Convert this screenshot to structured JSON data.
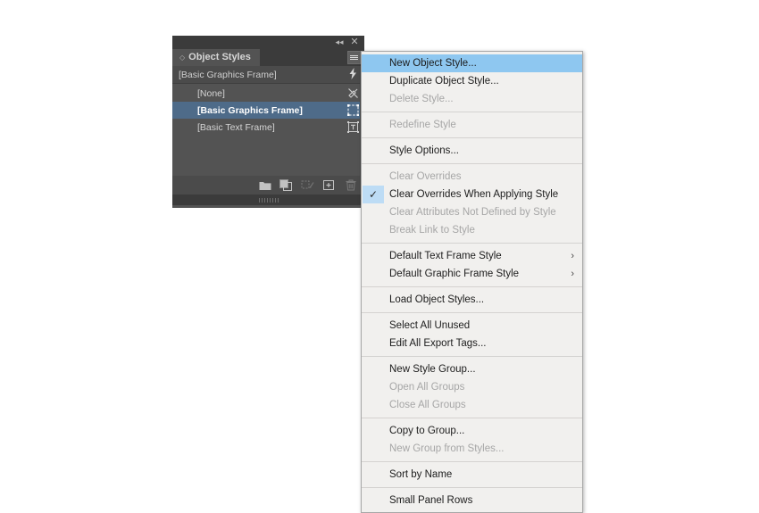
{
  "panel": {
    "title": "Object Styles",
    "collapse_icon": "◂◂",
    "close_icon": "✕",
    "menu_icon": "panel-menu-icon",
    "current_style": "[Basic Graphics Frame]",
    "current_style_icon": "⚡",
    "rows": [
      {
        "label": "[None]",
        "icon": "none-style-icon",
        "selected": false
      },
      {
        "label": "[Basic Graphics Frame]",
        "icon": "graphic-frame-icon",
        "selected": true
      },
      {
        "label": "[Basic Text Frame]",
        "icon": "text-frame-icon",
        "selected": false
      }
    ],
    "footer_buttons": [
      {
        "name": "new-style-group-button",
        "icon": "folder-icon",
        "disabled": false
      },
      {
        "name": "duplicate-style-button",
        "icon": "duplicate-icon",
        "disabled": false
      },
      {
        "name": "clear-overrides-button",
        "icon": "clear-overrides-icon",
        "disabled": true
      },
      {
        "name": "create-new-style-button",
        "icon": "plus-box-icon",
        "disabled": false
      },
      {
        "name": "delete-style-button",
        "icon": "trash-icon",
        "disabled": true
      }
    ]
  },
  "menu": {
    "items": [
      {
        "label": "New Object Style...",
        "state": "highlight"
      },
      {
        "label": "Duplicate Object Style...",
        "state": "enabled"
      },
      {
        "label": "Delete Style...",
        "state": "disabled"
      },
      {
        "separator": true
      },
      {
        "label": "Redefine Style",
        "state": "disabled"
      },
      {
        "separator": true
      },
      {
        "label": "Style Options...",
        "state": "enabled"
      },
      {
        "separator": true
      },
      {
        "label": "Clear Overrides",
        "state": "disabled"
      },
      {
        "label": "Clear Overrides When Applying Style",
        "state": "enabled",
        "checked": true
      },
      {
        "label": "Clear Attributes Not Defined by Style",
        "state": "disabled"
      },
      {
        "label": "Break Link to Style",
        "state": "disabled"
      },
      {
        "separator": true
      },
      {
        "label": "Default Text Frame Style",
        "state": "enabled",
        "submenu": true
      },
      {
        "label": "Default Graphic Frame Style",
        "state": "enabled",
        "submenu": true
      },
      {
        "separator": true
      },
      {
        "label": "Load Object Styles...",
        "state": "enabled"
      },
      {
        "separator": true
      },
      {
        "label": "Select All Unused",
        "state": "enabled"
      },
      {
        "label": "Edit All Export Tags...",
        "state": "enabled"
      },
      {
        "separator": true
      },
      {
        "label": "New Style Group...",
        "state": "enabled"
      },
      {
        "label": "Open All Groups",
        "state": "disabled"
      },
      {
        "label": "Close All Groups",
        "state": "disabled"
      },
      {
        "separator": true
      },
      {
        "label": "Copy to Group...",
        "state": "enabled"
      },
      {
        "label": "New Group from Styles...",
        "state": "disabled"
      },
      {
        "separator": true
      },
      {
        "label": "Sort by Name",
        "state": "enabled"
      },
      {
        "separator": true
      },
      {
        "label": "Small Panel Rows",
        "state": "enabled"
      }
    ],
    "check_glyph": "✓",
    "submenu_glyph": "›"
  },
  "colors": {
    "panel_bg": "#535353",
    "panel_chrome": "#3b3b3b",
    "selected_row": "#4e6b89",
    "menu_bg": "#f1f0ee",
    "menu_highlight": "#8ec7f0",
    "check_bg": "#bddcf5",
    "disabled_text": "#a6a6a6"
  }
}
